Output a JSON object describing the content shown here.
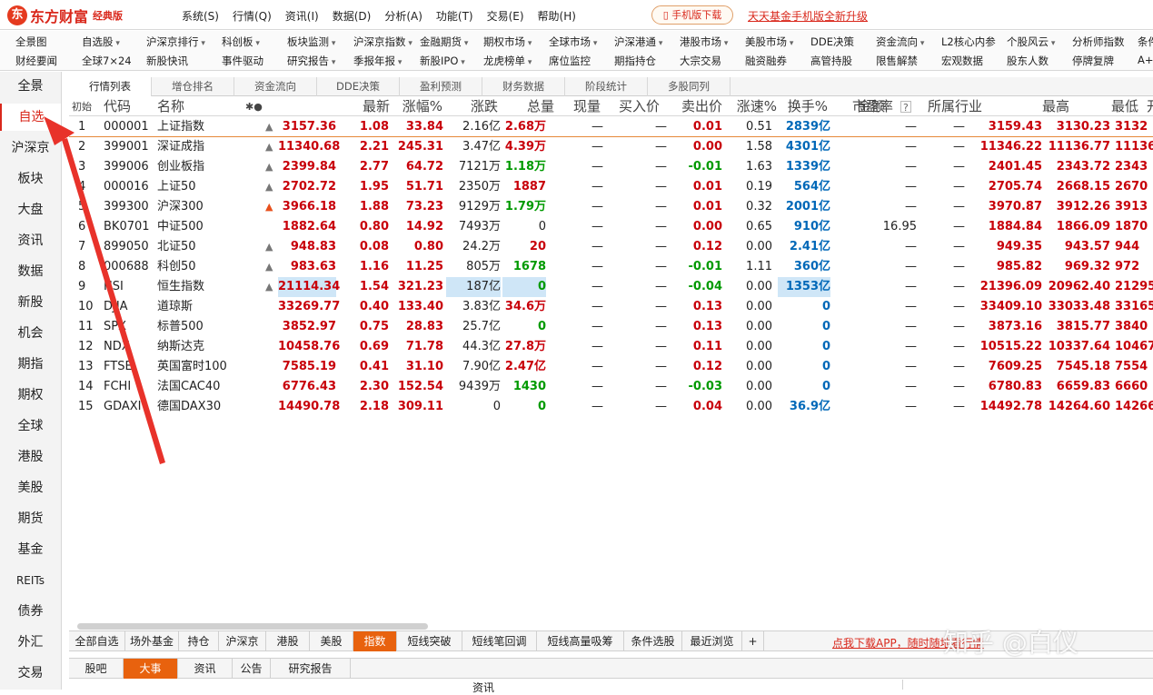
{
  "app": {
    "logo_mark": "东",
    "name": "东方财富",
    "edition": "经典版",
    "menu": [
      "系统(S)",
      "行情(Q)",
      "资讯(I)",
      "数据(D)",
      "分析(A)",
      "功能(T)",
      "交易(E)",
      "帮助(H)"
    ],
    "mobile_download": "手机版下载",
    "fund_link": "天天基金手机版全新升级"
  },
  "toolbar": {
    "row1": [
      "全景图",
      "自选股",
      "沪深京排行",
      "科创板",
      "板块监测",
      "沪深京指数",
      "金融期货",
      "期权市场",
      "全球市场",
      "沪深港通",
      "港股市场",
      "美股市场",
      "DDE决策",
      "资金流向",
      "L2核心内参",
      "个股风云",
      "分析师指数",
      "条件"
    ],
    "row2": [
      "财经要闻",
      "全球7×24",
      "新股快讯",
      "事件驱动",
      "研究报告",
      "季报年报",
      "新股IPO",
      "龙虎榜单",
      "席位监控",
      "期指持仓",
      "大宗交易",
      "融资融券",
      "高管持股",
      "限售解禁",
      "宏观数据",
      "股东人数",
      "停牌复牌",
      "A+H"
    ]
  },
  "sidebar": {
    "items": [
      "全景",
      "自选",
      "沪深京",
      "板块",
      "大盘",
      "资讯",
      "数据",
      "新股",
      "机会",
      "期指",
      "期权",
      "全球",
      "港股",
      "美股",
      "期货",
      "基金",
      "REITs",
      "债券",
      "外汇",
      "交易"
    ],
    "active": 1
  },
  "top_tabs": [
    "行情列表",
    "增仓排名",
    "资金流向",
    "DDE决策",
    "盈利预测",
    "财务数据",
    "阶段统计",
    "多股同列"
  ],
  "columns": {
    "init": "初始",
    "code": "代码",
    "name": "名称",
    "marks": "✱●",
    "latest": "最新",
    "change_pct": "涨幅%",
    "change": "涨跌",
    "volume": "总量",
    "current": "现量",
    "bid": "买入价",
    "ask": "卖出价",
    "speed": "涨速%",
    "turnover": "换手%",
    "amount": "金额",
    "pe": "市盈率",
    "pe_help": "?",
    "industry": "所属行业",
    "high": "最高",
    "low": "最低",
    "open": "开"
  },
  "rows": [
    {
      "no": "1",
      "code": "000001",
      "name": "上证指数",
      "latest": "3157.36",
      "pct": "1.08",
      "chg": "33.84",
      "vol": "2.16亿",
      "cur": "2.68万",
      "bid": "—",
      "ask": "—",
      "speed": "0.01",
      "turn": "0.51",
      "amount": "2839亿",
      "pe": "—",
      "ind": "—",
      "high": "3159.43",
      "low": "3130.23",
      "open": "3132"
    },
    {
      "no": "2",
      "code": "399001",
      "name": "深证成指",
      "latest": "11340.68",
      "pct": "2.21",
      "chg": "245.31",
      "vol": "3.47亿",
      "cur": "4.39万",
      "bid": "—",
      "ask": "—",
      "speed": "0.00",
      "turn": "1.58",
      "amount": "4301亿",
      "pe": "—",
      "ind": "—",
      "high": "11346.22",
      "low": "11136.77",
      "open": "11136"
    },
    {
      "no": "3",
      "code": "399006",
      "name": "创业板指",
      "latest": "2399.84",
      "pct": "2.77",
      "chg": "64.72",
      "vol": "7121万",
      "cur": "1.18万",
      "bid": "—",
      "ask": "—",
      "speed": "-0.01",
      "turn": "1.63",
      "amount": "1339亿",
      "pe": "—",
      "ind": "—",
      "high": "2401.45",
      "low": "2343.72",
      "open": "2343"
    },
    {
      "no": "4",
      "code": "000016",
      "name": "上证50",
      "latest": "2702.72",
      "pct": "1.95",
      "chg": "51.71",
      "vol": "2350万",
      "cur": "1887",
      "bid": "—",
      "ask": "—",
      "speed": "0.01",
      "turn": "0.19",
      "amount": "564亿",
      "pe": "—",
      "ind": "—",
      "high": "2705.74",
      "low": "2668.15",
      "open": "2670"
    },
    {
      "no": "5",
      "code": "399300",
      "name": "沪深300",
      "latest": "3966.18",
      "pct": "1.88",
      "chg": "73.23",
      "vol": "9129万",
      "cur": "1.79万",
      "bid": "—",
      "ask": "—",
      "speed": "0.01",
      "turn": "0.32",
      "amount": "2001亿",
      "pe": "—",
      "ind": "—",
      "high": "3970.87",
      "low": "3912.26",
      "open": "3913"
    },
    {
      "no": "6",
      "code": "BK0701",
      "name": "中证500",
      "latest": "1882.64",
      "pct": "0.80",
      "chg": "14.92",
      "vol": "7493万",
      "cur": "0",
      "bid": "—",
      "ask": "—",
      "speed": "0.00",
      "turn": "0.65",
      "amount": "910亿",
      "pe": "16.95",
      "ind": "—",
      "high": "1884.84",
      "low": "1866.09",
      "open": "1870"
    },
    {
      "no": "7",
      "code": "899050",
      "name": "北证50",
      "latest": "948.83",
      "pct": "0.08",
      "chg": "0.80",
      "vol": "24.2万",
      "cur": "20",
      "bid": "—",
      "ask": "—",
      "speed": "0.12",
      "turn": "0.00",
      "amount": "2.41亿",
      "pe": "—",
      "ind": "—",
      "high": "949.35",
      "low": "943.57",
      "open": "944"
    },
    {
      "no": "8",
      "code": "000688",
      "name": "科创50",
      "latest": "983.63",
      "pct": "1.16",
      "chg": "11.25",
      "vol": "805万",
      "cur": "1678",
      "bid": "—",
      "ask": "—",
      "speed": "-0.01",
      "turn": "1.11",
      "amount": "360亿",
      "pe": "—",
      "ind": "—",
      "high": "985.82",
      "low": "969.32",
      "open": "972"
    },
    {
      "no": "9",
      "code": "HSI",
      "name": "恒生指数",
      "latest": "21114.34",
      "pct": "1.54",
      "chg": "321.23",
      "vol": "187亿",
      "cur": "0",
      "bid": "—",
      "ask": "—",
      "speed": "-0.04",
      "turn": "0.00",
      "amount": "1353亿",
      "pe": "—",
      "ind": "—",
      "high": "21396.09",
      "low": "20962.40",
      "open": "21295"
    },
    {
      "no": "10",
      "code": "DJIA",
      "name": "道琼斯",
      "latest": "33269.77",
      "pct": "0.40",
      "chg": "133.40",
      "vol": "3.83亿",
      "cur": "34.6万",
      "bid": "—",
      "ask": "—",
      "speed": "0.13",
      "turn": "0.00",
      "amount": "0",
      "pe": "—",
      "ind": "—",
      "high": "33409.10",
      "low": "33033.48",
      "open": "33165"
    },
    {
      "no": "11",
      "code": "SPX",
      "name": "标普500",
      "latest": "3852.97",
      "pct": "0.75",
      "chg": "28.83",
      "vol": "25.7亿",
      "cur": "0",
      "bid": "—",
      "ask": "—",
      "speed": "0.13",
      "turn": "0.00",
      "amount": "0",
      "pe": "—",
      "ind": "—",
      "high": "3873.16",
      "low": "3815.77",
      "open": "3840"
    },
    {
      "no": "12",
      "code": "NDX",
      "name": "纳斯达克",
      "latest": "10458.76",
      "pct": "0.69",
      "chg": "71.78",
      "vol": "44.3亿",
      "cur": "27.8万",
      "bid": "—",
      "ask": "—",
      "speed": "0.11",
      "turn": "0.00",
      "amount": "0",
      "pe": "—",
      "ind": "—",
      "high": "10515.22",
      "low": "10337.64",
      "open": "10467"
    },
    {
      "no": "13",
      "code": "FTSE",
      "name": "英国富时100",
      "latest": "7585.19",
      "pct": "0.41",
      "chg": "31.10",
      "vol": "7.90亿",
      "cur": "2.47亿",
      "bid": "—",
      "ask": "—",
      "speed": "0.12",
      "turn": "0.00",
      "amount": "0",
      "pe": "—",
      "ind": "—",
      "high": "7609.25",
      "low": "7545.18",
      "open": "7554"
    },
    {
      "no": "14",
      "code": "FCHI",
      "name": "法国CAC40",
      "latest": "6776.43",
      "pct": "2.30",
      "chg": "152.54",
      "vol": "9439万",
      "cur": "1430",
      "bid": "—",
      "ask": "—",
      "speed": "-0.03",
      "turn": "0.00",
      "amount": "0",
      "pe": "—",
      "ind": "—",
      "high": "6780.83",
      "low": "6659.83",
      "open": "6660"
    },
    {
      "no": "15",
      "code": "GDAXI",
      "name": "德国DAX30",
      "latest": "14490.78",
      "pct": "2.18",
      "chg": "309.11",
      "vol": "0",
      "cur": "0",
      "bid": "—",
      "ask": "—",
      "speed": "0.04",
      "turn": "0.00",
      "amount": "36.9亿",
      "pe": "—",
      "ind": "—",
      "high": "14492.78",
      "low": "14264.60",
      "open": "14266"
    }
  ],
  "bottom_tabs": [
    "全部自选",
    "场外基金",
    "持仓",
    "沪深京",
    "港股",
    "美股",
    "指数",
    "短线突破",
    "短线笔回调",
    "短线高量吸筹",
    "条件选股",
    "最近浏览",
    "+"
  ],
  "bottom_active": 6,
  "promo": "点我下载APP，随时随地看行情",
  "news_tabs": [
    "股吧",
    "大事",
    "资讯",
    "公告",
    "研究报告"
  ],
  "news_active": 1,
  "news_caption": "资讯",
  "watermark": "知乎 @白仪",
  "colors": {
    "up": "#c8000a",
    "down": "#009a00",
    "accent": "#e8620e",
    "brand": "#d9281c",
    "amount": "#0068b8"
  }
}
